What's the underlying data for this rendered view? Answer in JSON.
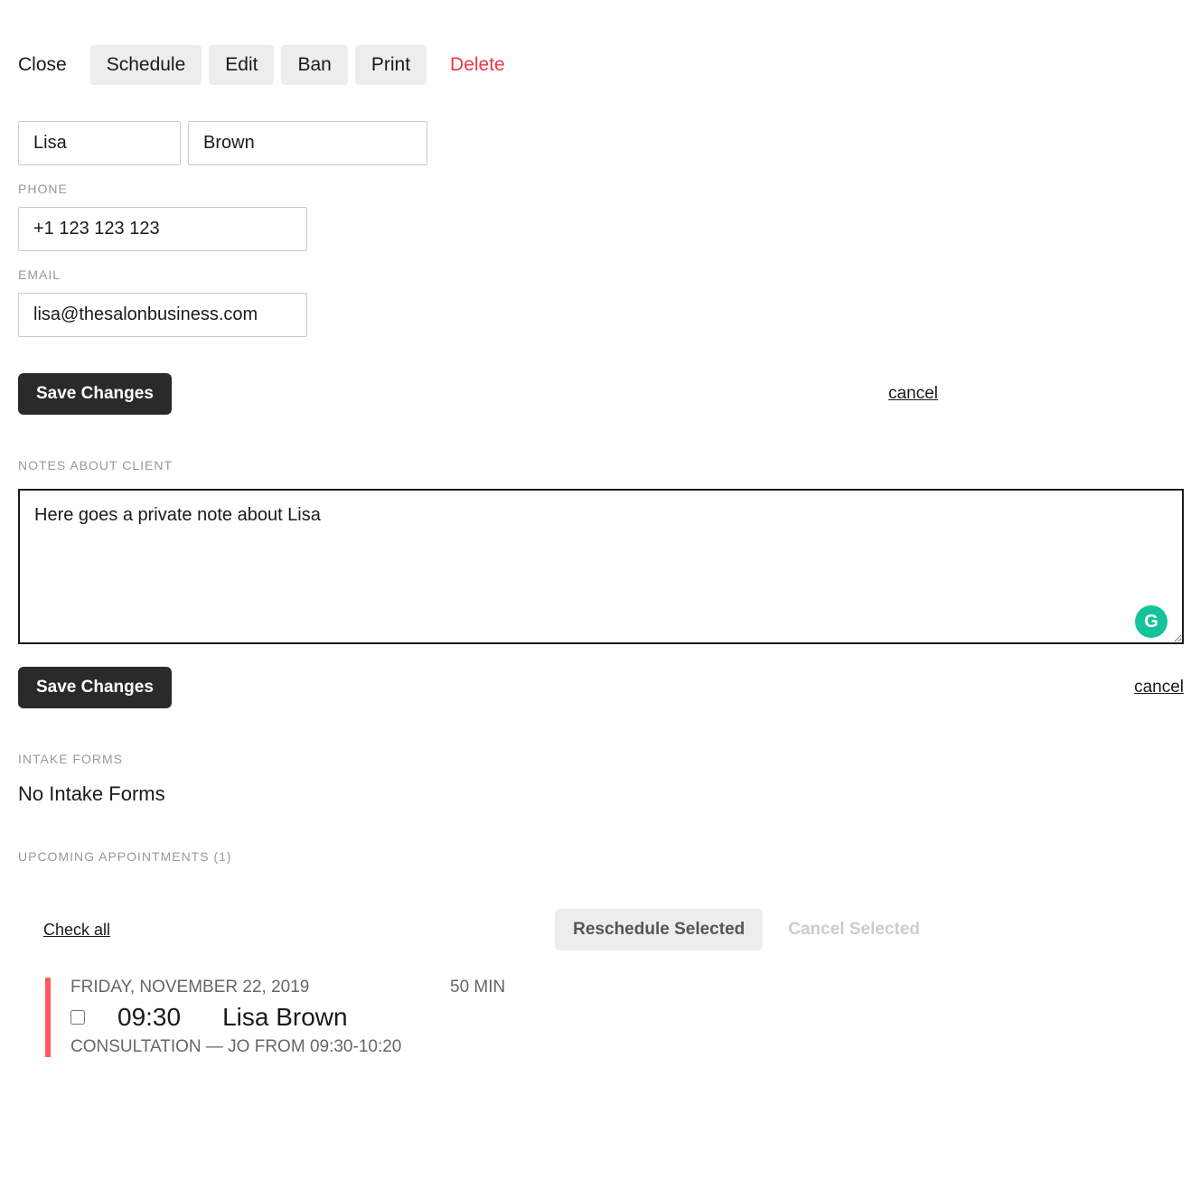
{
  "toolbar": {
    "close": "Close",
    "schedule": "Schedule",
    "edit": "Edit",
    "ban": "Ban",
    "print": "Print",
    "delete": "Delete"
  },
  "client": {
    "first_name": "Lisa",
    "last_name": "Brown",
    "phone": "+1 123 123 123",
    "email": "lisa@thesalonbusiness.com"
  },
  "labels": {
    "phone": "PHONE",
    "email": "EMAIL",
    "notes": "NOTES ABOUT CLIENT",
    "intake": "INTAKE FORMS",
    "upcoming": "UPCOMING APPOINTMENTS (1)"
  },
  "buttons": {
    "save_changes": "Save Changes",
    "cancel": "cancel",
    "check_all": "Check all",
    "reschedule": "Reschedule Selected",
    "cancel_selected": "Cancel Selected"
  },
  "notes": {
    "text": "Here goes a private note about Lisa"
  },
  "intake": {
    "none": "No Intake Forms"
  },
  "appointment": {
    "date": "FRIDAY, NOVEMBER 22, 2019",
    "duration": "50 MIN",
    "time": "09:30",
    "name": "Lisa Brown",
    "detail": "CONSULTATION — JO FROM 09:30-10:20"
  },
  "grammarly": "G"
}
